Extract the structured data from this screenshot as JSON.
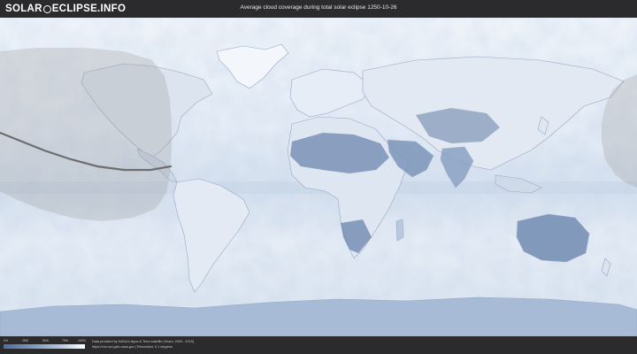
{
  "header": {
    "logo_left": "SOLAR",
    "logo_right": "ECLIPSE.INFO",
    "title": "Average cloud coverage during total solar eclipse 1250-10-26"
  },
  "legend": {
    "ticks": [
      "0%",
      "25%",
      "50%",
      "75%",
      "100%"
    ],
    "colors": [
      "#4f6e99",
      "#7c97bb",
      "#b4c6dd",
      "#ffffff"
    ]
  },
  "credits": {
    "line1": "Data provided by NASA's Aqua & Terra satellite (Years: 2000 - 2019)",
    "line2": "https://neo.sci.gsfc.nasa.gov | Resolution: 0.1 degrees"
  },
  "map": {
    "ocean_color": "#e6edf6",
    "shadow_color": "#9a9a9a",
    "centerline_color": "#6e6e6e",
    "centerline": [
      [
        0,
        130
      ],
      [
        25,
        140
      ],
      [
        50,
        150
      ],
      [
        80,
        160
      ],
      [
        110,
        168
      ],
      [
        140,
        172
      ],
      [
        170,
        172
      ],
      [
        193,
        168
      ]
    ]
  }
}
